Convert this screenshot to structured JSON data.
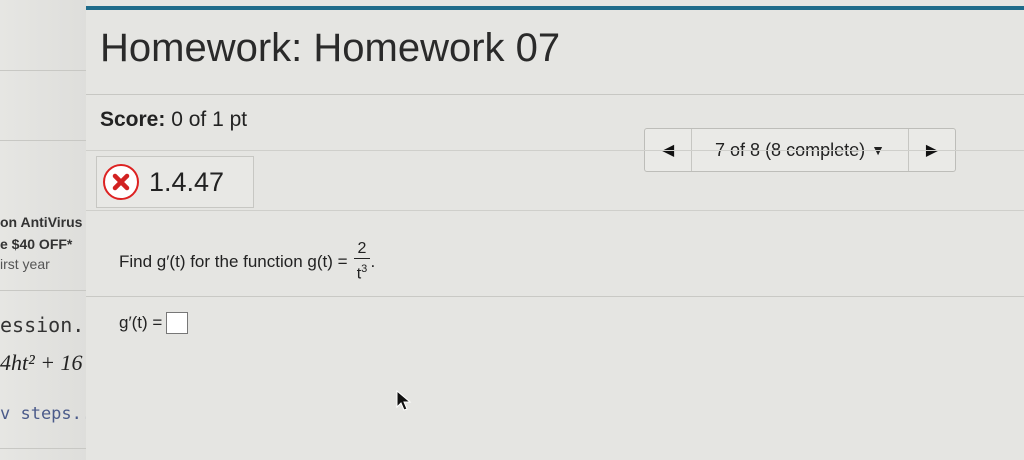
{
  "background_window": {
    "ad_line1": "on AntiVirus I",
    "ad_line2": "e $40 OFF*",
    "ad_line3": "irst year",
    "session_text": "ession.",
    "expression": "4ht² + 16",
    "steps_link": "v steps..."
  },
  "header": {
    "title": "Homework: Homework 07",
    "score_label": "Score:",
    "score_value": "0 of 1 pt"
  },
  "navigator": {
    "progress": "7 of 8 (8 complete)",
    "prev_icon": "triangle-left-icon",
    "next_icon": "triangle-right-icon"
  },
  "question": {
    "status_icon": "incorrect-x-icon",
    "status_color": "#d22222",
    "number": "1.4.47",
    "prompt_text": "Find g′(t) for the function g(t) =",
    "numerator": "2",
    "denominator_base": "t",
    "denominator_exp": "3",
    "prompt_end": ".",
    "answer_label": "g′(t) ="
  },
  "colors": {
    "accent": "#1f6b8a"
  }
}
